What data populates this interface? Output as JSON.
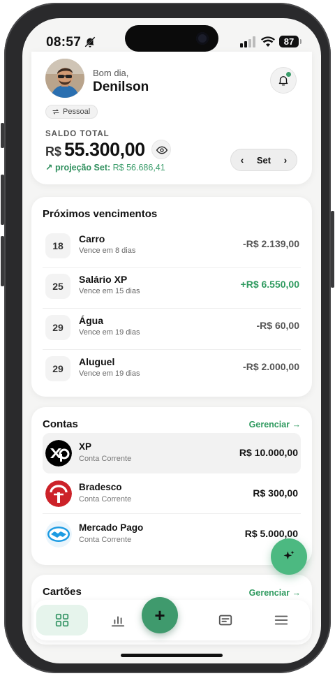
{
  "status_bar": {
    "time": "08:57",
    "battery": "87"
  },
  "header": {
    "greeting": "Bom dia,",
    "name": "Denilson",
    "profile_chip": "Pessoal",
    "balance_label": "SALDO TOTAL",
    "currency": "R$",
    "balance": "55.300,00",
    "projection_label": "projeção Set:",
    "projection_value": "R$ 56.686,41",
    "month": "Set"
  },
  "upcoming": {
    "title": "Próximos vencimentos",
    "items": [
      {
        "day": "18",
        "name": "Carro",
        "due": "Vence em 8 dias",
        "amount": "-R$ 2.139,00"
      },
      {
        "day": "25",
        "name": "Salário XP",
        "due": "Vence em 15 dias",
        "amount": "+R$ 6.550,00"
      },
      {
        "day": "29",
        "name": "Água",
        "due": "Vence em 19 dias",
        "amount": "-R$ 60,00"
      },
      {
        "day": "29",
        "name": "Aluguel",
        "due": "Vence em 19 dias",
        "amount": "-R$ 2.000,00"
      }
    ]
  },
  "accounts": {
    "title": "Contas",
    "manage_label": "Gerenciar →",
    "items": [
      {
        "name": "XP",
        "type": "Conta Corrente",
        "balance": "R$ 10.000,00",
        "logo": "xp-logo"
      },
      {
        "name": "Bradesco",
        "type": "Conta Corrente",
        "balance": "R$ 300,00",
        "logo": "bradesco-logo"
      },
      {
        "name": "Mercado Pago",
        "type": "Conta Corrente",
        "balance": "R$ 5.000,00",
        "logo": "mercado-pago-logo"
      }
    ]
  },
  "cards": {
    "title": "Cartões",
    "manage_label": "Gerenciar →"
  },
  "bottom_nav": {
    "items": [
      "dashboard-icon",
      "chart-icon",
      "add-icon",
      "receipt-icon",
      "menu-icon"
    ],
    "add_label": "+"
  },
  "colors": {
    "accent": "#3f9a6d",
    "positive": "#2f9a5f",
    "negative": "#555555"
  }
}
